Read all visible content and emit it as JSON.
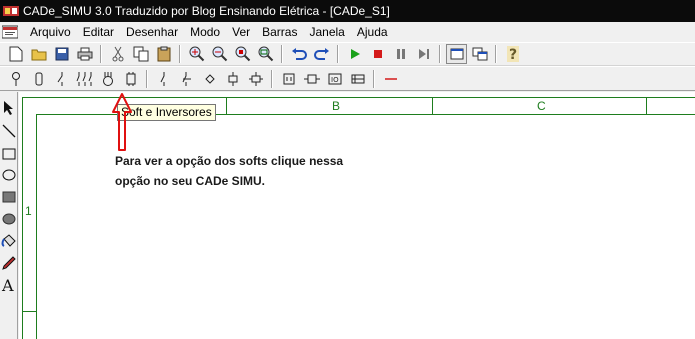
{
  "window": {
    "title": "CADe_SIMU 3.0 Traduzido por Blog Ensinando Elétrica - [CADe_S1]",
    "app_icon": "cade-simu-app-icon"
  },
  "menubar": {
    "items": [
      "Arquivo",
      "Editar",
      "Desenhar",
      "Modo",
      "Ver",
      "Barras",
      "Janela",
      "Ajuda"
    ]
  },
  "toolbar_main": {
    "icons": [
      "new-file-icon",
      "open-folder-icon",
      "save-icon",
      "print-icon",
      "cut-icon",
      "copy-icon",
      "paste-icon",
      "zoom-in-icon",
      "zoom-out-icon",
      "zoom-fit-icon",
      "zoom-window-icon",
      "undo-icon",
      "redo-icon",
      "play-icon",
      "stop-icon",
      "pause-icon",
      "step-icon",
      "window-icon",
      "multi-window-icon",
      "help-icon"
    ]
  },
  "toolbar_components": {
    "icons": [
      "lamp-icon",
      "fuse-icon",
      "contact-icon",
      "relay-contacts-icon",
      "motor-icon",
      "soft-inverter-icon",
      "contact-no-icon",
      "contact-nc-icon",
      "diamond-icon",
      "coil-icon",
      "timer-icon",
      "terminal-icon",
      "connector-icon",
      "io-icon",
      "plc-icon",
      "line-icon"
    ]
  },
  "left_tools": {
    "icons": [
      "pointer-icon",
      "line-draw-icon",
      "rectangle-icon",
      "ellipse-icon",
      "filled-rectangle-icon",
      "filled-ellipse-icon",
      "fill-bucket-icon",
      "pen-icon",
      "text-icon"
    ]
  },
  "canvas": {
    "columns": [
      "B",
      "C"
    ],
    "rows": [
      "1"
    ]
  },
  "tooltip": {
    "text": "Soft e Inversores"
  },
  "annotation": {
    "line1": "Para ver a opção dos softs clique nessa",
    "line2": "opção no seu CADe SIMU."
  },
  "colors": {
    "grid": "#1e7d1e",
    "arrow": "#e01010",
    "titlebar": "#0b0b0b",
    "tooltip_bg": "#ffffe1"
  }
}
